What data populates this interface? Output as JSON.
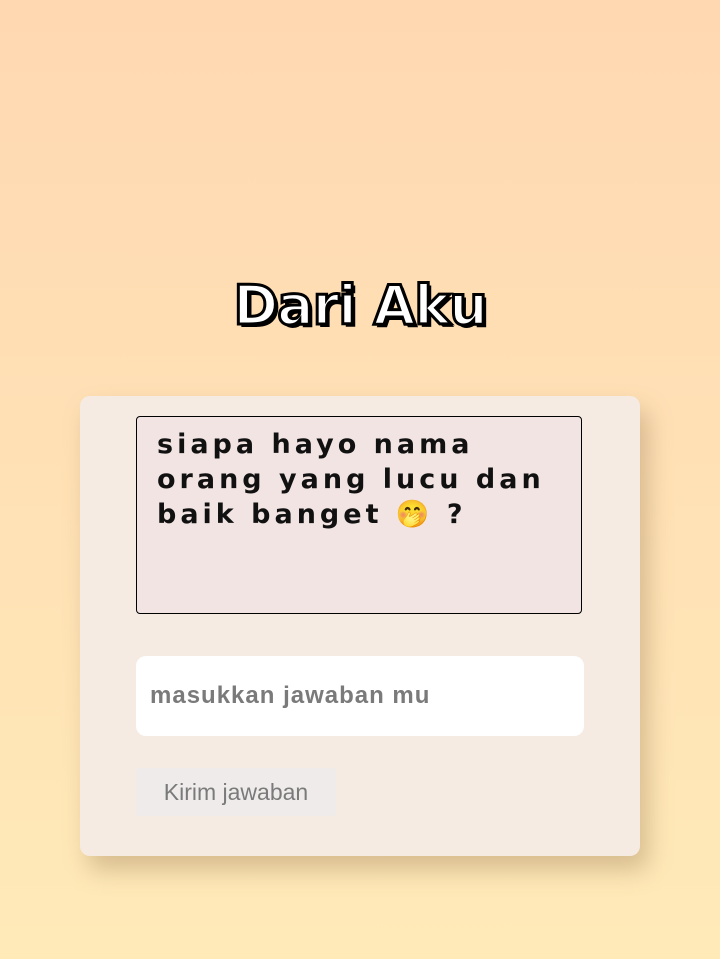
{
  "header": {
    "title": "Dari Aku"
  },
  "question": {
    "text": "siapa hayo nama orang yang lucu dan baik banget 🤭 ?"
  },
  "answer": {
    "placeholder": "masukkan jawaban mu",
    "value": ""
  },
  "submit": {
    "label": "Kirim jawaban"
  }
}
